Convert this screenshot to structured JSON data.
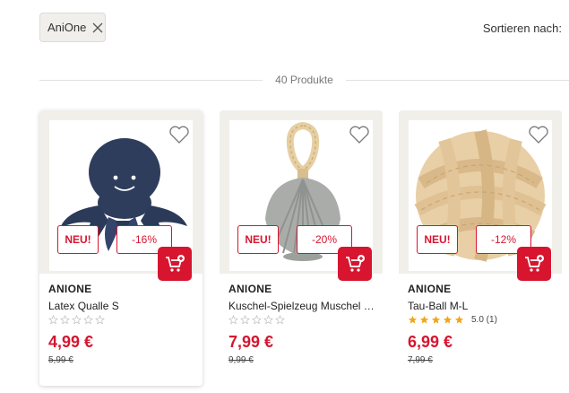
{
  "filter": {
    "chip_label": "AniOne"
  },
  "sort": {
    "label": "Sortieren nach:"
  },
  "results": {
    "count_label": "40 Produkte"
  },
  "colors": {
    "accent": "#d7152f",
    "star_filled": "#f2a61c",
    "star_empty": "#cfcfcf"
  },
  "products": [
    {
      "brand": "ANIONE",
      "name": "Latex Qualle S",
      "badge_new": "NEU!",
      "badge_discount": "-16%",
      "price": "4,99 €",
      "old_price": "5,99 €",
      "rating_stars": 0,
      "rating_text": ""
    },
    {
      "brand": "ANIONE",
      "name": "Kuschel-Spielzeug Muschel mit Seil",
      "badge_new": "NEU!",
      "badge_discount": "-20%",
      "price": "7,99 €",
      "old_price": "9,99 €",
      "rating_stars": 0,
      "rating_text": ""
    },
    {
      "brand": "ANIONE",
      "name": "Tau-Ball M-L",
      "badge_new": "NEU!",
      "badge_discount": "-12%",
      "price": "6,99 €",
      "old_price": "7,99 €",
      "rating_stars": 5,
      "rating_text": "5.0 (1)"
    }
  ]
}
